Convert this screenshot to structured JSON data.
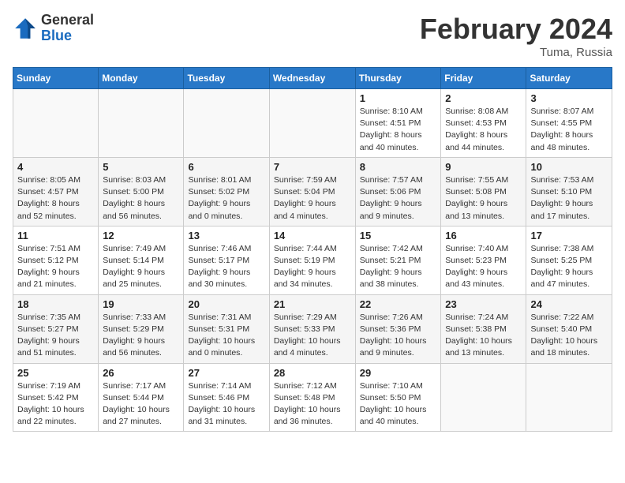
{
  "header": {
    "logo_general": "General",
    "logo_blue": "Blue",
    "month_title": "February 2024",
    "location": "Tuma, Russia"
  },
  "weekdays": [
    "Sunday",
    "Monday",
    "Tuesday",
    "Wednesday",
    "Thursday",
    "Friday",
    "Saturday"
  ],
  "weeks": [
    [
      {
        "day": "",
        "info": ""
      },
      {
        "day": "",
        "info": ""
      },
      {
        "day": "",
        "info": ""
      },
      {
        "day": "",
        "info": ""
      },
      {
        "day": "1",
        "info": "Sunrise: 8:10 AM\nSunset: 4:51 PM\nDaylight: 8 hours and 40 minutes."
      },
      {
        "day": "2",
        "info": "Sunrise: 8:08 AM\nSunset: 4:53 PM\nDaylight: 8 hours and 44 minutes."
      },
      {
        "day": "3",
        "info": "Sunrise: 8:07 AM\nSunset: 4:55 PM\nDaylight: 8 hours and 48 minutes."
      }
    ],
    [
      {
        "day": "4",
        "info": "Sunrise: 8:05 AM\nSunset: 4:57 PM\nDaylight: 8 hours and 52 minutes."
      },
      {
        "day": "5",
        "info": "Sunrise: 8:03 AM\nSunset: 5:00 PM\nDaylight: 8 hours and 56 minutes."
      },
      {
        "day": "6",
        "info": "Sunrise: 8:01 AM\nSunset: 5:02 PM\nDaylight: 9 hours and 0 minutes."
      },
      {
        "day": "7",
        "info": "Sunrise: 7:59 AM\nSunset: 5:04 PM\nDaylight: 9 hours and 4 minutes."
      },
      {
        "day": "8",
        "info": "Sunrise: 7:57 AM\nSunset: 5:06 PM\nDaylight: 9 hours and 9 minutes."
      },
      {
        "day": "9",
        "info": "Sunrise: 7:55 AM\nSunset: 5:08 PM\nDaylight: 9 hours and 13 minutes."
      },
      {
        "day": "10",
        "info": "Sunrise: 7:53 AM\nSunset: 5:10 PM\nDaylight: 9 hours and 17 minutes."
      }
    ],
    [
      {
        "day": "11",
        "info": "Sunrise: 7:51 AM\nSunset: 5:12 PM\nDaylight: 9 hours and 21 minutes."
      },
      {
        "day": "12",
        "info": "Sunrise: 7:49 AM\nSunset: 5:14 PM\nDaylight: 9 hours and 25 minutes."
      },
      {
        "day": "13",
        "info": "Sunrise: 7:46 AM\nSunset: 5:17 PM\nDaylight: 9 hours and 30 minutes."
      },
      {
        "day": "14",
        "info": "Sunrise: 7:44 AM\nSunset: 5:19 PM\nDaylight: 9 hours and 34 minutes."
      },
      {
        "day": "15",
        "info": "Sunrise: 7:42 AM\nSunset: 5:21 PM\nDaylight: 9 hours and 38 minutes."
      },
      {
        "day": "16",
        "info": "Sunrise: 7:40 AM\nSunset: 5:23 PM\nDaylight: 9 hours and 43 minutes."
      },
      {
        "day": "17",
        "info": "Sunrise: 7:38 AM\nSunset: 5:25 PM\nDaylight: 9 hours and 47 minutes."
      }
    ],
    [
      {
        "day": "18",
        "info": "Sunrise: 7:35 AM\nSunset: 5:27 PM\nDaylight: 9 hours and 51 minutes."
      },
      {
        "day": "19",
        "info": "Sunrise: 7:33 AM\nSunset: 5:29 PM\nDaylight: 9 hours and 56 minutes."
      },
      {
        "day": "20",
        "info": "Sunrise: 7:31 AM\nSunset: 5:31 PM\nDaylight: 10 hours and 0 minutes."
      },
      {
        "day": "21",
        "info": "Sunrise: 7:29 AM\nSunset: 5:33 PM\nDaylight: 10 hours and 4 minutes."
      },
      {
        "day": "22",
        "info": "Sunrise: 7:26 AM\nSunset: 5:36 PM\nDaylight: 10 hours and 9 minutes."
      },
      {
        "day": "23",
        "info": "Sunrise: 7:24 AM\nSunset: 5:38 PM\nDaylight: 10 hours and 13 minutes."
      },
      {
        "day": "24",
        "info": "Sunrise: 7:22 AM\nSunset: 5:40 PM\nDaylight: 10 hours and 18 minutes."
      }
    ],
    [
      {
        "day": "25",
        "info": "Sunrise: 7:19 AM\nSunset: 5:42 PM\nDaylight: 10 hours and 22 minutes."
      },
      {
        "day": "26",
        "info": "Sunrise: 7:17 AM\nSunset: 5:44 PM\nDaylight: 10 hours and 27 minutes."
      },
      {
        "day": "27",
        "info": "Sunrise: 7:14 AM\nSunset: 5:46 PM\nDaylight: 10 hours and 31 minutes."
      },
      {
        "day": "28",
        "info": "Sunrise: 7:12 AM\nSunset: 5:48 PM\nDaylight: 10 hours and 36 minutes."
      },
      {
        "day": "29",
        "info": "Sunrise: 7:10 AM\nSunset: 5:50 PM\nDaylight: 10 hours and 40 minutes."
      },
      {
        "day": "",
        "info": ""
      },
      {
        "day": "",
        "info": ""
      }
    ]
  ]
}
